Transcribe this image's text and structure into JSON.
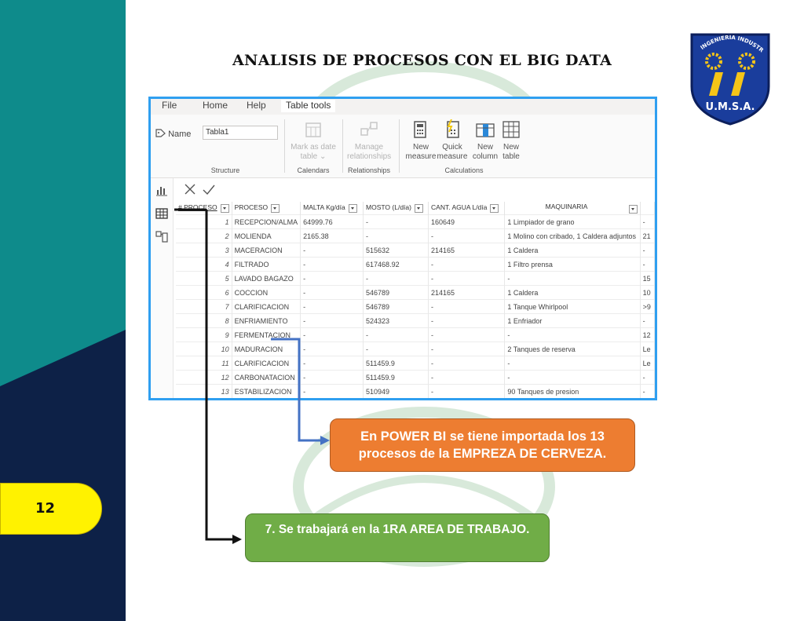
{
  "slide": {
    "title": "ANALISIS DE PROCESOS CON EL BIG DATA",
    "page_number": "12",
    "logo": {
      "arc_text": "INGENIERIA INDUSTRIAL",
      "abbr": "U.M.S.A."
    },
    "colors": {
      "teal": "#0e8b8b",
      "navy": "#0d2147",
      "yellow": "#fff200",
      "orange": "#ed7d31",
      "green": "#70ad47",
      "frame_blue": "#2f9ff0"
    }
  },
  "app": {
    "menu": [
      "File",
      "Home",
      "Help",
      "Table tools"
    ],
    "active_menu": "Table tools",
    "name_label": "Name",
    "name_value": "Tabla1",
    "ribbon": {
      "mark_as_date": [
        "Mark as date",
        "table"
      ],
      "manage": [
        "Manage",
        "relationships"
      ],
      "new_measure": [
        "New",
        "measure"
      ],
      "quick_measure": [
        "Quick",
        "measure"
      ],
      "new_column": [
        "New",
        "column"
      ],
      "new_table": [
        "New",
        "table"
      ],
      "groups": {
        "structure": "Structure",
        "calendars": "Calendars",
        "relationships": "Relationships",
        "calculations": "Calculations"
      }
    },
    "table": {
      "columns": [
        "# PROCESO",
        "PROCESO",
        "MALTA Kg/día",
        "MOSTO (L/día)",
        "CANT. AGUA L/día",
        "MAQUINARIA",
        ""
      ],
      "rows": [
        [
          "1",
          "RECEPCION/ALMA",
          "64999.76",
          "-",
          "160649",
          "1 Limpiador de grano",
          "-"
        ],
        [
          "2",
          "MOLIENDA",
          "2165.38",
          "-",
          "-",
          "1 Molino con cribado, 1 Caldera adjuntos",
          "21"
        ],
        [
          "3",
          "MACERACION",
          "-",
          "515632",
          "214165",
          "1 Caldera",
          "-"
        ],
        [
          "4",
          "FILTRADO",
          "-",
          "617468.92",
          "-",
          "1 Filtro prensa",
          "-"
        ],
        [
          "5",
          "LAVADO BAGAZO",
          "-",
          "-",
          "-",
          "-",
          "15"
        ],
        [
          "6",
          "COCCION",
          "-",
          "546789",
          "214165",
          "1 Caldera",
          "10"
        ],
        [
          "7",
          "CLARIFICACION",
          "-",
          "546789",
          "-",
          "1 Tanque Whirlpool",
          ">9"
        ],
        [
          "8",
          "ENFRIAMIENTO",
          "-",
          "524323",
          "-",
          "1 Enfriador",
          "-"
        ],
        [
          "9",
          "FERMENTACION",
          "-",
          "-",
          "-",
          "-",
          "12"
        ],
        [
          "10",
          "MADURACION",
          "-",
          "-",
          "-",
          "2 Tanques de reserva",
          "Le"
        ],
        [
          "11",
          "CLARIFICACION",
          "-",
          "511459.9",
          "-",
          "-",
          "Le"
        ],
        [
          "12",
          "CARBONATACION",
          "-",
          "511459.9",
          "-",
          "-",
          "-"
        ],
        [
          "13",
          "ESTABILIZACION",
          "-",
          "510949",
          "-",
          "90 Tanques de presion",
          "-"
        ]
      ]
    }
  },
  "callouts": {
    "orange": "En POWER BI se tiene importada los 13 procesos de la EMPREZA DE CERVEZA.",
    "green": "7. Se trabajará en la 1RA AREA DE TRABAJO."
  }
}
